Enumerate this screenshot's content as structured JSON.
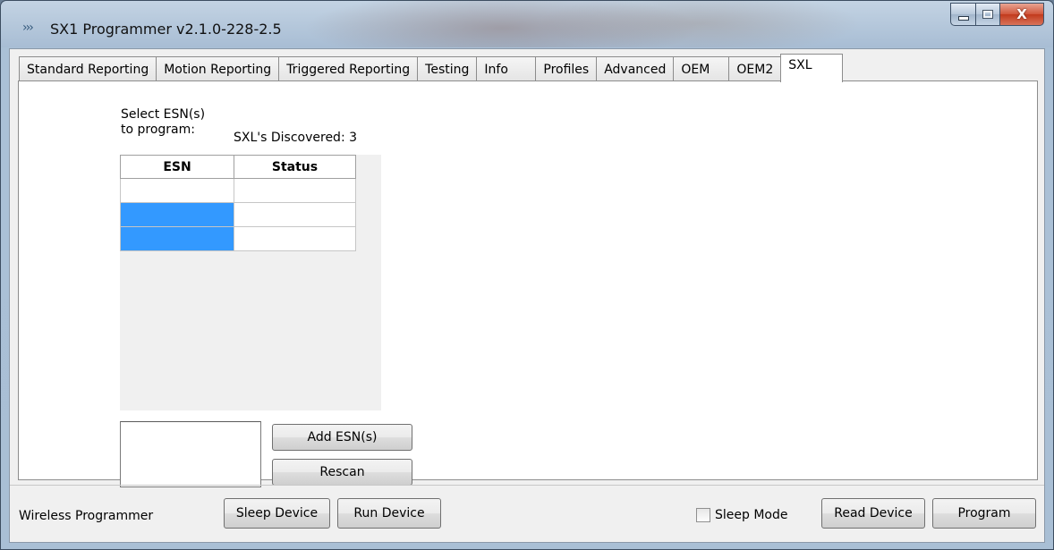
{
  "window": {
    "title": "SX1 Programmer v2.1.0-228-2.5",
    "app_icon": "signal-arrows-icon",
    "close_glyph": "X"
  },
  "tabs": [
    {
      "label": "Standard Reporting",
      "active": false
    },
    {
      "label": "Motion Reporting",
      "active": false
    },
    {
      "label": "Triggered Reporting",
      "active": false
    },
    {
      "label": "Testing",
      "active": false
    },
    {
      "label": "Info",
      "active": false
    },
    {
      "label": "Profiles",
      "active": false
    },
    {
      "label": "Advanced",
      "active": false
    },
    {
      "label": "OEM",
      "active": false
    },
    {
      "label": "OEM2",
      "active": false
    },
    {
      "label": "SXL",
      "active": true
    }
  ],
  "sxl": {
    "select_label_line1": "Select ESN(s)",
    "select_label_line2": "to program:",
    "discovered_label": "SXL's Discovered: 3",
    "grid": {
      "columns": [
        "ESN",
        "Status"
      ],
      "rows": [
        {
          "esn": "",
          "status": "",
          "selected": false
        },
        {
          "esn": "",
          "status": "",
          "selected": true
        },
        {
          "esn": "",
          "status": "",
          "selected": true
        }
      ]
    },
    "esn_input_value": "",
    "add_button": "Add ESN(s)",
    "rescan_button": "Rescan"
  },
  "footer": {
    "mode_label": "Wireless Programmer",
    "sleep_device_button": "Sleep Device",
    "run_device_button": "Run Device",
    "sleep_mode_label": "Sleep Mode",
    "sleep_mode_checked": false,
    "read_device_button": "Read Device",
    "program_button": "Program"
  },
  "colors": {
    "selection": "#3399ff",
    "close_button": "#c9472b",
    "tab_panel_bg": "#ffffff",
    "window_bg": "#f0f0f0"
  }
}
